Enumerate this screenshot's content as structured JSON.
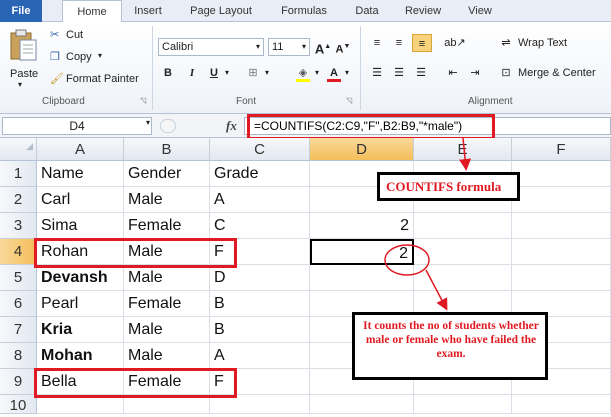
{
  "ribbon": {
    "tabs": [
      "File",
      "Home",
      "Insert",
      "Page Layout",
      "Formulas",
      "Data",
      "Review",
      "View"
    ],
    "active_tab": "Home",
    "clipboard": {
      "paste": "Paste",
      "cut": "Cut",
      "copy": "Copy",
      "format_painter": "Format Painter",
      "label": "Clipboard"
    },
    "font": {
      "name": "Calibri",
      "size": "11",
      "bold": "B",
      "italic": "I",
      "underline": "U",
      "label": "Font"
    },
    "alignment": {
      "wrap_text": "Wrap Text",
      "merge_center": "Merge & Center",
      "label": "Alignment"
    }
  },
  "formula_bar": {
    "name_box": "D4",
    "fx": "fx",
    "formula": "=COUNTIFS(C2:C9,\"F\",B2:B9,\"*male\")"
  },
  "sheet": {
    "columns": [
      "A",
      "B",
      "C",
      "D",
      "E",
      "F"
    ],
    "selected_column": "D",
    "selected_row": "4",
    "rows": [
      {
        "n": "1",
        "a": "Name",
        "b": "Gender",
        "c": "Grade",
        "d": ""
      },
      {
        "n": "2",
        "a": "Carl",
        "b": "Male",
        "c": "A",
        "d": ""
      },
      {
        "n": "3",
        "a": "Sima",
        "b": "Female",
        "c": "C",
        "d": "2"
      },
      {
        "n": "4",
        "a": "Rohan",
        "b": "Male",
        "c": "F",
        "d": "2"
      },
      {
        "n": "5",
        "a": "Devansh",
        "b": "Male",
        "c": "D",
        "d": ""
      },
      {
        "n": "6",
        "a": "Pearl",
        "b": "Female",
        "c": "B",
        "d": ""
      },
      {
        "n": "7",
        "a": "Kria",
        "b": "Male",
        "c": "B",
        "d": ""
      },
      {
        "n": "8",
        "a": "Mohan",
        "b": "Male",
        "c": "A",
        "d": ""
      },
      {
        "n": "9",
        "a": "Bella",
        "b": "Female",
        "c": "F",
        "d": ""
      },
      {
        "n": "10",
        "a": "",
        "b": "",
        "c": "",
        "d": ""
      }
    ]
  },
  "annotations": {
    "formula_label": "COUNTIFS formula",
    "explanation": "It counts the no of students whether male or female who have failed the exam."
  },
  "colors": {
    "accent_red": "#e01a22",
    "annotation_text": "#e01a22",
    "file_tab": "#2a64b5"
  }
}
